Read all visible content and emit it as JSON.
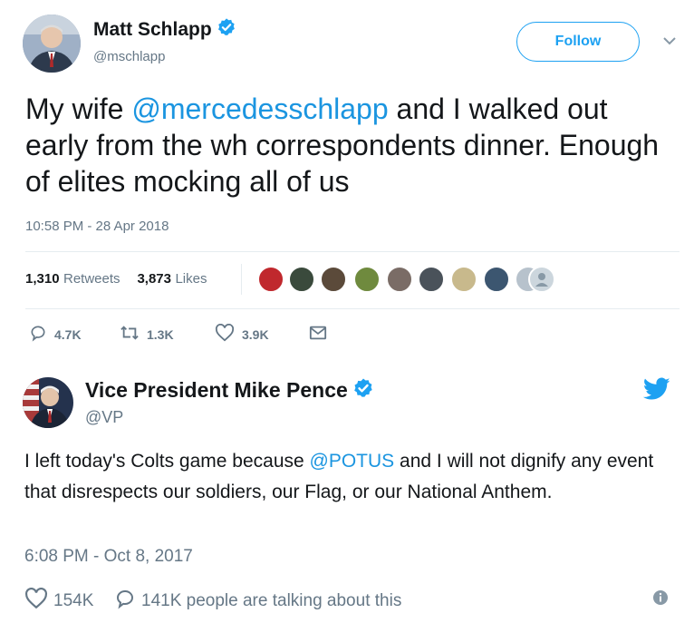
{
  "tweet1": {
    "name": "Matt Schlapp",
    "handle": "@mschlapp",
    "follow_label": "Follow",
    "text_before": "My wife ",
    "mention": "@mercedesschlapp",
    "text_after": " and I walked out early from the wh correspondents dinner. Enough of elites mocking all of us",
    "timestamp": "10:58 PM - 28 Apr 2018",
    "retweets_count": "1,310",
    "retweets_label": "Retweets",
    "likes_count": "3,873",
    "likes_label": "Likes",
    "actions": {
      "reply_count": "4.7K",
      "retweet_count": "1.3K",
      "like_count": "3.9K"
    }
  },
  "tweet2": {
    "name": "Vice President Mike Pence",
    "handle": "@VP",
    "text_before": "I left today's Colts game because ",
    "mention": "@POTUS",
    "text_after": " and I will not dignify any event that disrespects our soldiers, our Flag, or our National Anthem.",
    "timestamp": "6:08 PM - Oct 8, 2017",
    "likes_count": "154K",
    "talking_text": "141K people are talking about this"
  },
  "colors": {
    "accent": "#1da1f2",
    "mention": "#1b95e0",
    "muted": "#657786",
    "text": "#14171a",
    "verified": "#1da1f2"
  }
}
